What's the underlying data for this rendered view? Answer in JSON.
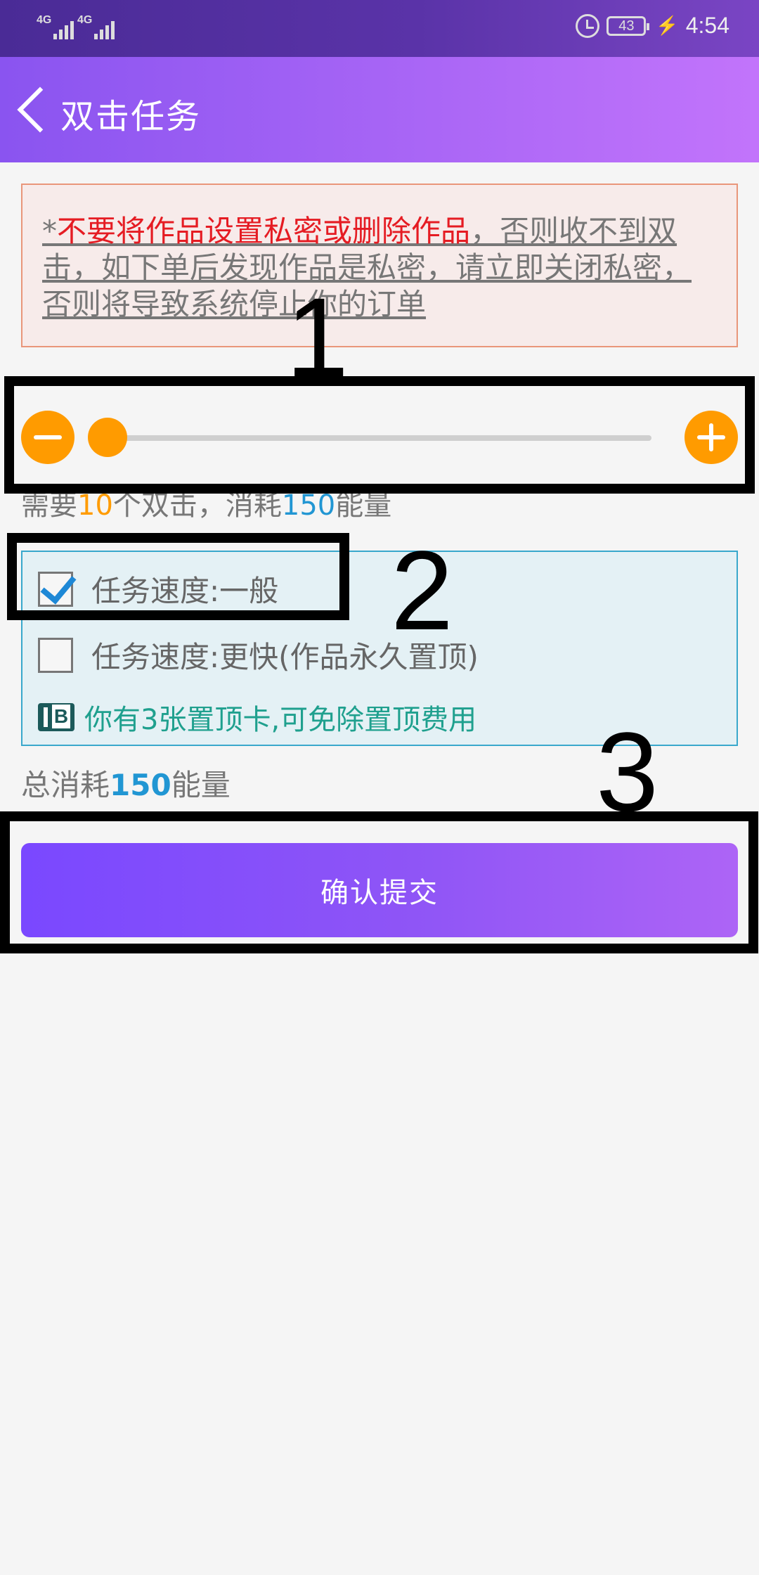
{
  "status_bar": {
    "network_1": "4G",
    "network_2": "4G",
    "battery": "43",
    "time": "4:54"
  },
  "header": {
    "title": "双击任务"
  },
  "warning": {
    "prefix": "*",
    "highlight": "不要将作品设置私密或删除作品",
    "rest": "，否则收不到双击，如下单后发现作品是私密，请立即关闭私密，否则将导致系统停止你的订单"
  },
  "slider": {
    "value_fraction": 0.0
  },
  "need": {
    "prefix": "需要",
    "count": "10",
    "mid": "个双击，消耗",
    "energy": "150",
    "suffix": "能量"
  },
  "speed_options": [
    {
      "label": "任务速度:一般",
      "checked": true
    },
    {
      "label": "任务速度:更快(作品永久置顶)",
      "checked": false
    }
  ],
  "top_card": {
    "text": "你有3张置顶卡,可免除置顶费用"
  },
  "total": {
    "prefix": "总消耗",
    "value": "150",
    "suffix": "能量"
  },
  "submit_label": "确认提交",
  "annotations": [
    "1",
    "2",
    "3"
  ]
}
